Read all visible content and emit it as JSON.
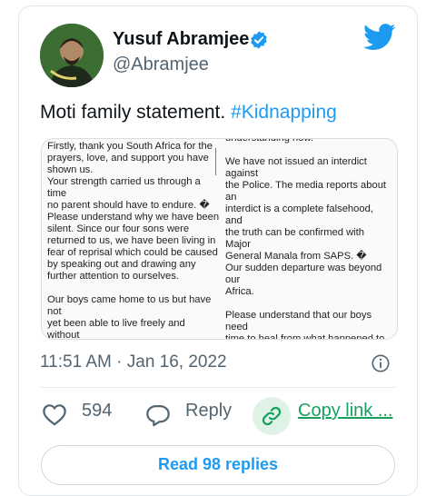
{
  "author": {
    "name": "Yusuf Abramjee",
    "handle": "@Abramjee",
    "verified": true
  },
  "tweet": {
    "text_prefix": "Moti family statement. ",
    "hashtag": "#Kidnapping"
  },
  "statement_image": {
    "left_column": "Firstly, thank you South Africa for the\nprayers, love, and support you have\nshown us.\nYour strength carried us through a time\nno parent should have to endure. �\nPlease understand why we have been\nsilent. Since our four sons were\nreturned to us, we have been living in\nfear of reprisal which could be caused\nby speaking out and drawing any\nfurther attention to ourselves.\n\nOur boys came home to us but have not\nyet been able to live freely and without\nfear. We have been forced to make\nsome difficult decisions to ensure their",
    "right_column": "understanding now.\n\nWe have not issued an interdict against\nthe Police. The media reports about an\ninterdict is a complete falsehood, and\nthe truth can be confirmed with Major\nGeneral Manala from SAPS. �\nOur sudden departure was beyond our\nAfrica.\n\nPlease understand that our boys need\ntime to heal from what happened to\nthem one morning on their way to\nschool. We appeal to you all for privacy\nand your continued understanding so\nthat these innocent young boys can go"
  },
  "meta": {
    "timestamp": "11:51 AM · Jan 16, 2022"
  },
  "actions": {
    "like_count": "594",
    "reply_label": "Reply",
    "copy_link_label": "Copy link ..."
  },
  "footer": {
    "replies_button": "Read 98 replies"
  },
  "colors": {
    "accent": "#1d9bf0",
    "copy_link": "#17a05d",
    "secondary_text": "#536471"
  },
  "icons": [
    "verified-badge-icon",
    "twitter-bird-icon",
    "info-icon",
    "heart-icon",
    "reply-bubble-icon",
    "link-icon"
  ]
}
